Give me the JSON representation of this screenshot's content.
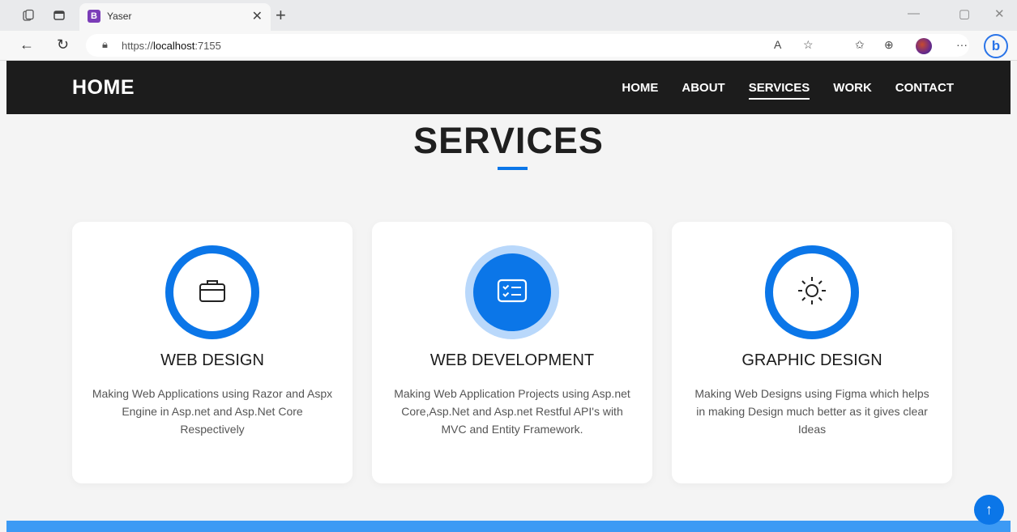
{
  "browser": {
    "tab_title": "Yaser",
    "tab_favicon_letter": "B",
    "url_prefix": "https://",
    "url_host": "localhost",
    "url_port": ":7155"
  },
  "site": {
    "brand": "HOME",
    "nav": [
      "HOME",
      "ABOUT",
      "SERVICES",
      "WORK",
      "CONTACT"
    ],
    "active_nav": "SERVICES"
  },
  "services": {
    "title": "SERVICES",
    "cards": [
      {
        "title": "WEB DESIGN",
        "description": "Making Web Applications using Razor and Aspx Engine in Asp.net and Asp.Net Core Respectively",
        "icon": "briefcase-icon"
      },
      {
        "title": "WEB DEVELOPMENT",
        "description": "Making Web Application Projects using Asp.net Core,Asp.Net and Asp.net Restful API's with MVC and Entity Framework.",
        "icon": "card-checklist-icon"
      },
      {
        "title": "GRAPHIC DESIGN",
        "description": "Making Web Designs using Figma which helps in making Design much better as it gives clear Ideas",
        "icon": "sun-icon"
      }
    ]
  },
  "colors": {
    "accent": "#0b76e8",
    "nav_bg": "#1c1c1c",
    "page_bg": "#f4f4f4"
  }
}
